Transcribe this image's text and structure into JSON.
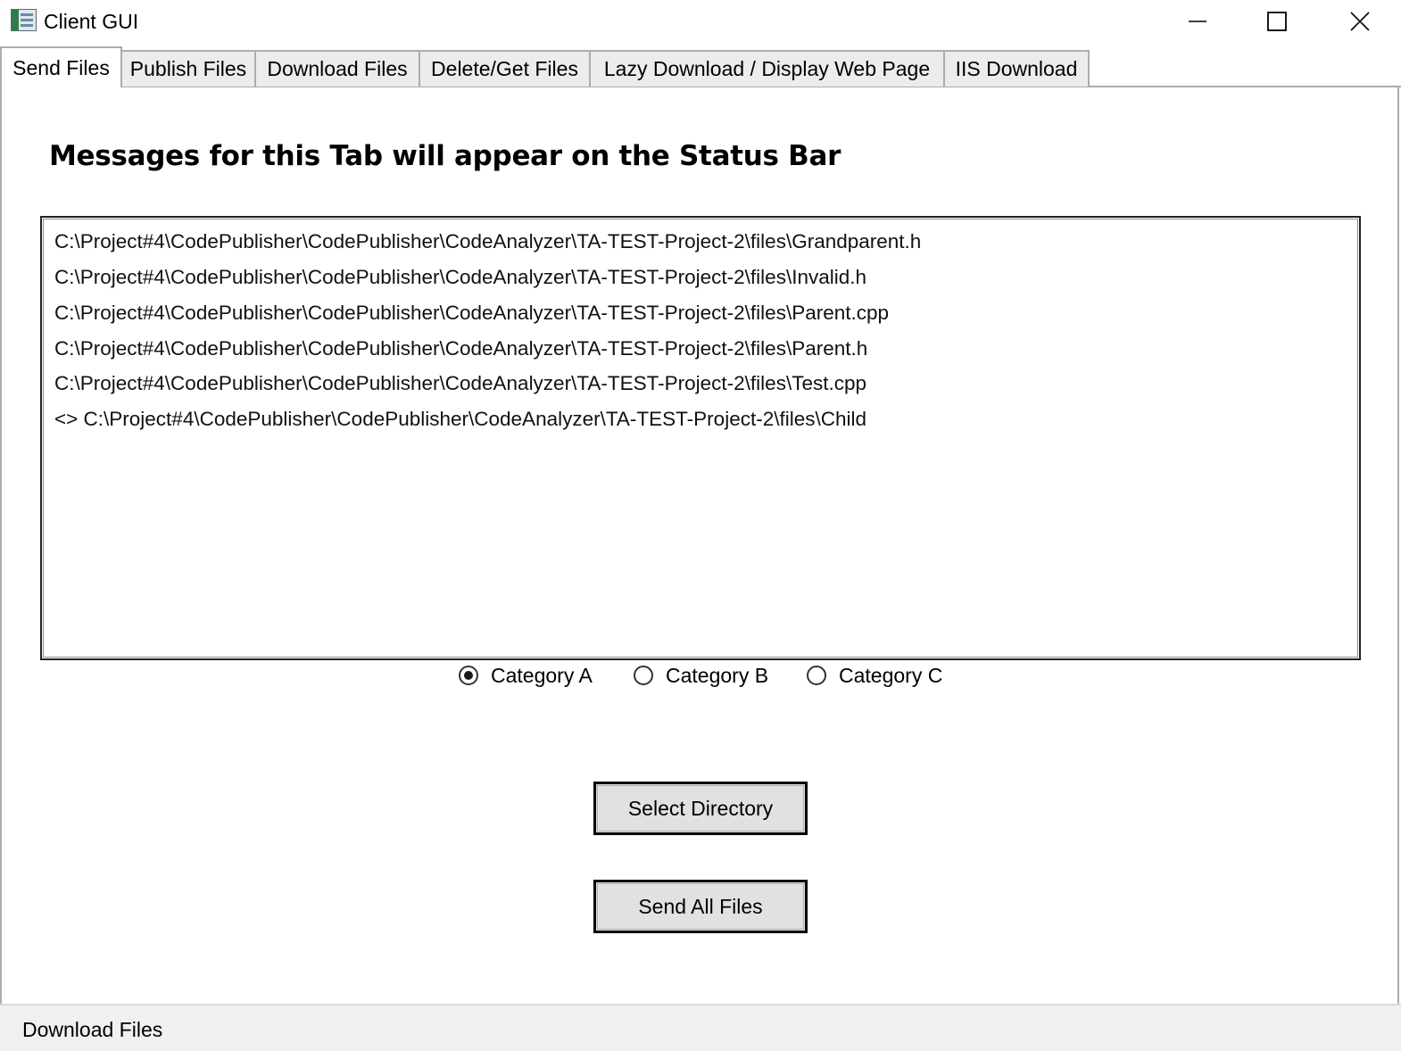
{
  "window": {
    "title": "Client GUI",
    "icon": "app-window-icon",
    "controls": [
      "minimize-icon",
      "maximize-icon",
      "close-icon"
    ]
  },
  "tabs": [
    {
      "label": "Send Files",
      "active": true
    },
    {
      "label": "Publish Files",
      "active": false
    },
    {
      "label": "Download Files",
      "active": false
    },
    {
      "label": "Delete/Get Files",
      "active": false
    },
    {
      "label": "Lazy Download / Display Web Page",
      "active": false
    },
    {
      "label": "IIS Download",
      "active": false
    }
  ],
  "main": {
    "heading": "Messages for this Tab will appear on the Status Bar",
    "files": [
      "C:\\Project#4\\CodePublisher\\CodePublisher\\CodeAnalyzer\\TA-TEST-Project-2\\files\\Grandparent.h",
      "C:\\Project#4\\CodePublisher\\CodePublisher\\CodeAnalyzer\\TA-TEST-Project-2\\files\\Invalid.h",
      "C:\\Project#4\\CodePublisher\\CodePublisher\\CodeAnalyzer\\TA-TEST-Project-2\\files\\Parent.cpp",
      "C:\\Project#4\\CodePublisher\\CodePublisher\\CodeAnalyzer\\TA-TEST-Project-2\\files\\Parent.h",
      "C:\\Project#4\\CodePublisher\\CodePublisher\\CodeAnalyzer\\TA-TEST-Project-2\\files\\Test.cpp",
      "<> C:\\Project#4\\CodePublisher\\CodePublisher\\CodeAnalyzer\\TA-TEST-Project-2\\files\\Child"
    ],
    "categories": [
      {
        "label": "Category A",
        "checked": true
      },
      {
        "label": "Category B",
        "checked": false
      },
      {
        "label": "Category C",
        "checked": false
      }
    ],
    "select_directory_label": "Select Directory",
    "send_all_label": "Send All Files"
  },
  "statusbar": {
    "text": "Download Files"
  },
  "colors": {
    "tab_background": "#ececec",
    "tab_border": "#acacac",
    "button_background": "#e1e1e1",
    "statusbar_background": "#f0f0f0"
  }
}
